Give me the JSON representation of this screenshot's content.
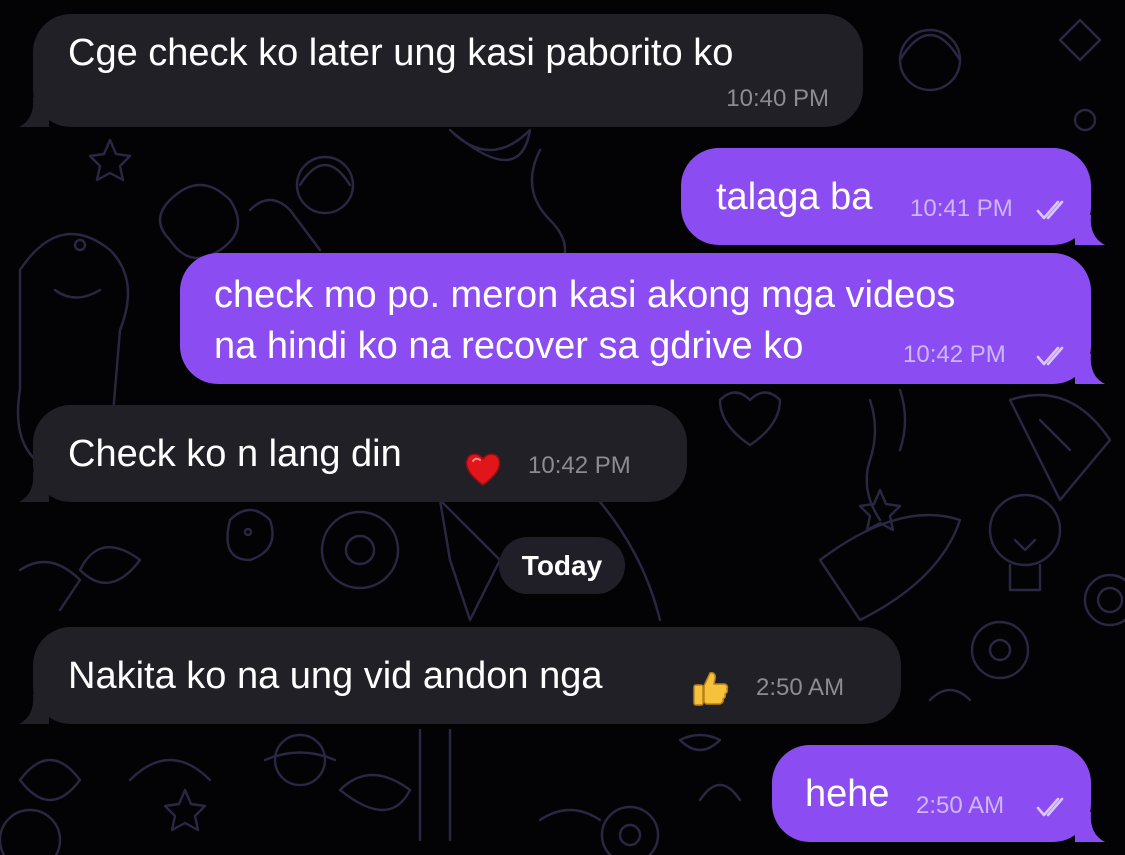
{
  "colors": {
    "background": "#030306",
    "incoming_bubble": "#222027",
    "outgoing_bubble": "#8b4df2",
    "doodle_stroke": "#2a2742",
    "reaction_heart": "#e0161b",
    "reaction_thumb": "#f6c23b"
  },
  "messages": [
    {
      "direction": "incoming",
      "text": "Cge check ko later ung kasi paborito ko",
      "time": "10:40 PM"
    },
    {
      "direction": "outgoing",
      "text": "talaga ba",
      "time": "10:41 PM",
      "status": "read-double-check"
    },
    {
      "direction": "outgoing",
      "lines": [
        "check mo po. meron kasi akong mga videos",
        "na hindi ko na recover sa gdrive ko"
      ],
      "time": "10:42 PM",
      "status": "read-double-check"
    },
    {
      "direction": "incoming",
      "text": "Check ko n lang din",
      "time": "10:42 PM",
      "reaction": "heart-icon"
    },
    {
      "direction": "incoming",
      "text": "Nakita ko na ung vid andon nga",
      "time": "2:50 AM",
      "reaction": "thumbs-up-icon"
    },
    {
      "direction": "outgoing",
      "text": "hehe",
      "time": "2:50 AM",
      "status": "read-double-check"
    }
  ],
  "date_separator": "Today"
}
